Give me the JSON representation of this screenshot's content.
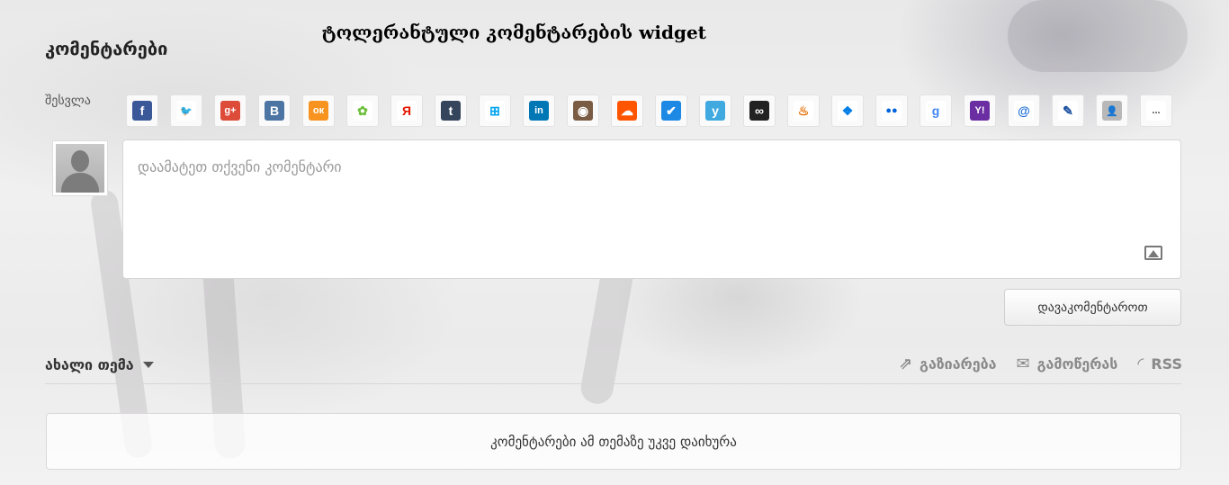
{
  "banner": "ტოლერანტული კომენტარების widget",
  "title": "კომენტარები",
  "login_label": "შესვლა",
  "social": [
    {
      "name": "facebook-icon",
      "glyph": "f",
      "bg": "#3b5998",
      "fg": "#ffffff"
    },
    {
      "name": "twitter-icon",
      "glyph": "🐦",
      "bg": "#ffffff",
      "fg": "#1da1f2"
    },
    {
      "name": "google-plus-icon",
      "glyph": "g+",
      "bg": "#dd4b39",
      "fg": "#ffffff"
    },
    {
      "name": "vkontakte-icon",
      "glyph": "B",
      "bg": "#4c75a3",
      "fg": "#ffffff"
    },
    {
      "name": "odnoklassniki-icon",
      "glyph": "ок",
      "bg": "#f7931e",
      "fg": "#ffffff"
    },
    {
      "name": "mail-agent-icon",
      "glyph": "✿",
      "bg": "#ffffff",
      "fg": "#6dbf3b"
    },
    {
      "name": "yandex-icon",
      "glyph": "Я",
      "bg": "#ffffff",
      "fg": "#e61400"
    },
    {
      "name": "tumblr-icon",
      "glyph": "t",
      "bg": "#35465c",
      "fg": "#ffffff"
    },
    {
      "name": "windows-live-icon",
      "glyph": "⊞",
      "bg": "#ffffff",
      "fg": "#00a4ef"
    },
    {
      "name": "linkedin-icon",
      "glyph": "in",
      "bg": "#0077b5",
      "fg": "#ffffff"
    },
    {
      "name": "instagram-icon",
      "glyph": "◉",
      "bg": "#7a5c44",
      "fg": "#ffffff"
    },
    {
      "name": "soundcloud-icon",
      "glyph": "☁",
      "bg": "#ff5500",
      "fg": "#ffffff"
    },
    {
      "name": "foursquare-check-icon",
      "glyph": "✔",
      "bg": "#1e88e5",
      "fg": "#ffffff"
    },
    {
      "name": "yammer-icon",
      "glyph": "y",
      "bg": "#3fa9e0",
      "fg": "#ffffff"
    },
    {
      "name": "lastfm-icon",
      "glyph": "∞",
      "bg": "#222222",
      "fg": "#ffffff"
    },
    {
      "name": "java-openid-icon",
      "glyph": "♨",
      "bg": "#ffffff",
      "fg": "#e76f00"
    },
    {
      "name": "dropbox-icon",
      "glyph": "❖",
      "bg": "#ffffff",
      "fg": "#007ee5"
    },
    {
      "name": "flickr-icon",
      "glyph": "●●",
      "bg": "#ffffff",
      "fg": "#0063dc"
    },
    {
      "name": "google-icon",
      "glyph": "g",
      "bg": "#ffffff",
      "fg": "#4285f4"
    },
    {
      "name": "yahoo-icon",
      "glyph": "Y!",
      "bg": "#6a2ea2",
      "fg": "#ffffff"
    },
    {
      "name": "email-at-icon",
      "glyph": "@",
      "bg": "#ffffff",
      "fg": "#1e6fd9"
    },
    {
      "name": "livejournal-pencil-icon",
      "glyph": "✎",
      "bg": "#ffffff",
      "fg": "#1a4fa0"
    },
    {
      "name": "guest-user-icon",
      "glyph": "👤",
      "bg": "#b8b8b8",
      "fg": "#777777"
    },
    {
      "name": "more-icon",
      "glyph": "...",
      "bg": "#ffffff",
      "fg": "#444444"
    }
  ],
  "comment": {
    "placeholder": "დაამატეთ თქვენი კომენტარი"
  },
  "submit_label": "დავაკომენტაროთ",
  "sort_label": "ახალი თემა",
  "actions": {
    "share": "გაზიარება",
    "subscribe": "გამოწერას",
    "rss": "RSS"
  },
  "closed_message": "კომენტარები ამ თემაზე უკვე დაიხურა"
}
